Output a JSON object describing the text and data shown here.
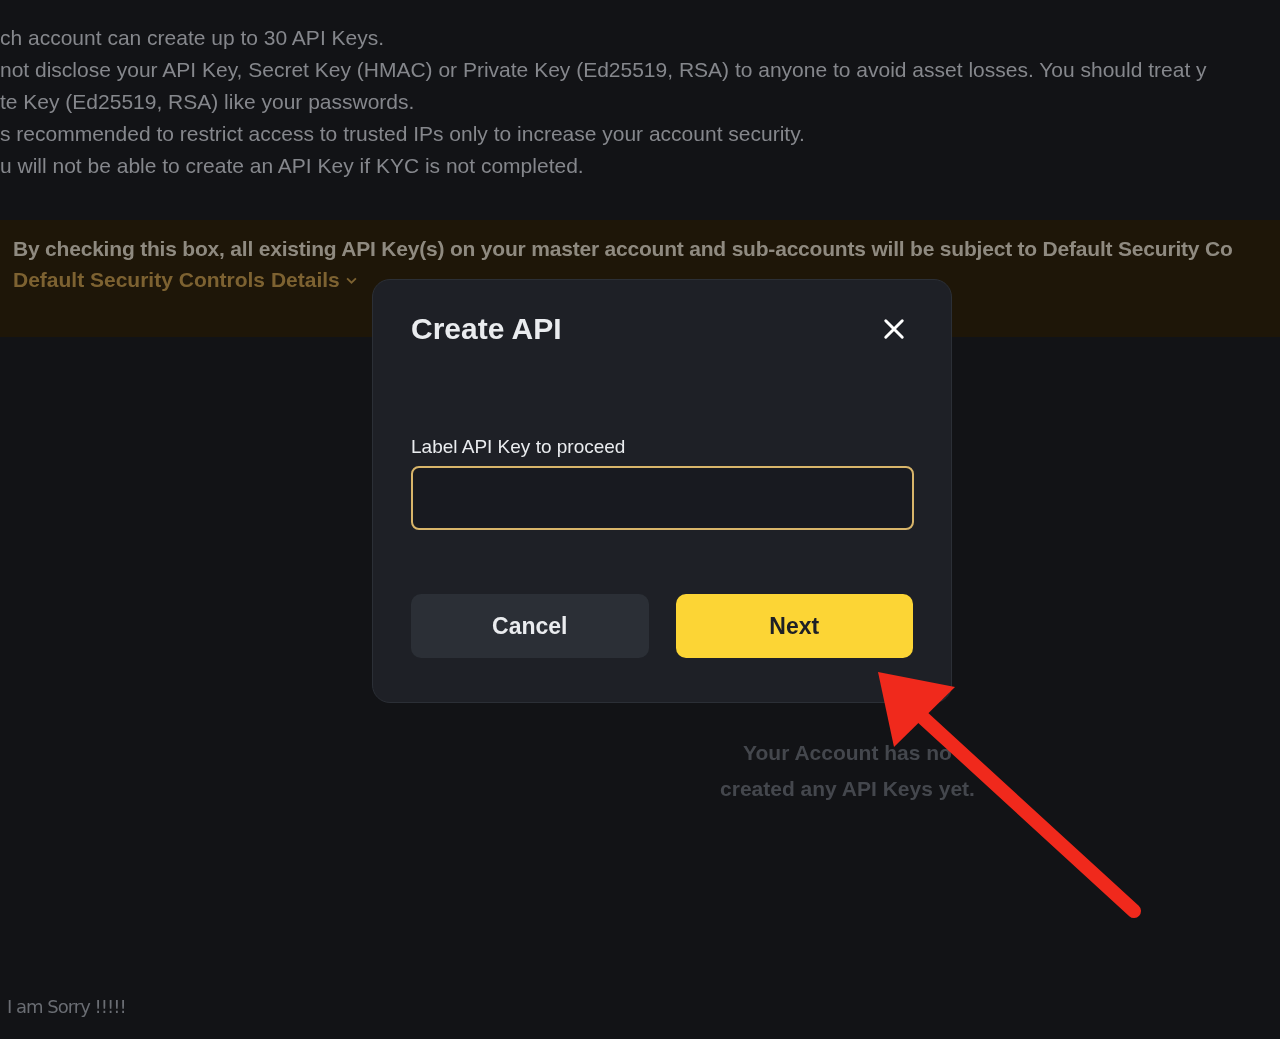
{
  "notes": [
    "ch account can create up to 30 API Keys.",
    "not disclose your API Key, Secret Key (HMAC) or Private Key (Ed25519, RSA) to anyone to avoid asset losses. You should treat y",
    "te Key (Ed25519, RSA) like your passwords.",
    "s recommended to restrict access to trusted IPs only to increase your account security.",
    "u will not be able to create an API Key if KYC is not completed."
  ],
  "banner": {
    "text": "By checking this box, all existing API Key(s) on your master account and sub-accounts will be subject to Default Security Co",
    "link": "Default Security Controls Details"
  },
  "empty_state": {
    "lines": [
      "Your Account has no",
      "created any API Keys yet."
    ]
  },
  "dialog": {
    "title": "Create API",
    "field": {
      "label": "Label API Key to proceed",
      "focused": true
    },
    "buttons": [
      {
        "label": "Cancel",
        "kind": "secondary"
      },
      {
        "label": "Next",
        "kind": "primary"
      }
    ]
  },
  "footer_note": "I am Sorry !!!!!"
}
